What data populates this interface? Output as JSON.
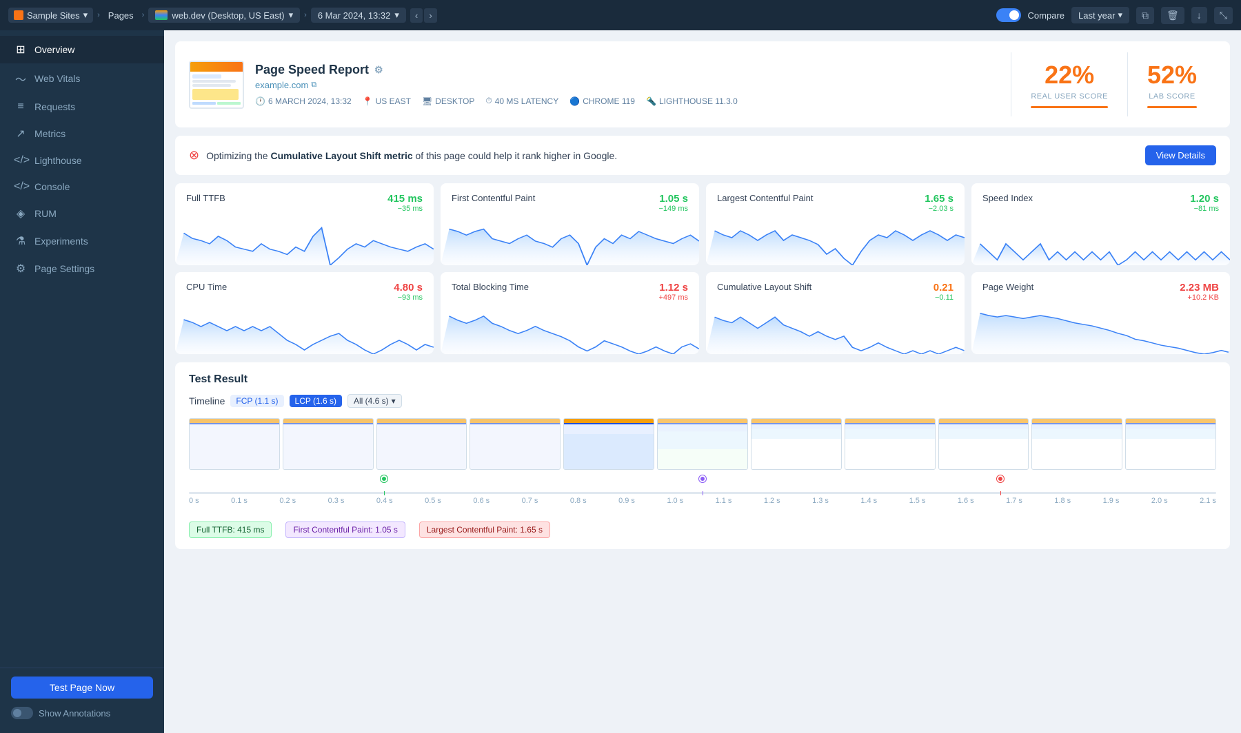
{
  "topNav": {
    "sampleSites": "Sample Sites",
    "pages": "Pages",
    "url": "web.dev (Desktop, US East)",
    "date": "6 Mar 2024, 13:32",
    "compareLabel": "Compare",
    "lastYear": "Last year"
  },
  "sidebar": {
    "items": [
      {
        "id": "overview",
        "label": "Overview",
        "icon": "⊞",
        "active": true
      },
      {
        "id": "web-vitals",
        "label": "Web Vitals",
        "icon": "〜"
      },
      {
        "id": "requests",
        "label": "Requests",
        "icon": "≡"
      },
      {
        "id": "metrics",
        "label": "Metrics",
        "icon": "↗"
      },
      {
        "id": "lighthouse",
        "label": "Lighthouse",
        "icon": "</>"
      },
      {
        "id": "console",
        "label": "Console",
        "icon": "</>"
      },
      {
        "id": "rum",
        "label": "RUM",
        "icon": "◈"
      },
      {
        "id": "experiments",
        "label": "Experiments",
        "icon": "⚗"
      },
      {
        "id": "page-settings",
        "label": "Page Settings",
        "icon": "⚙"
      }
    ],
    "testNowLabel": "Test Page Now",
    "showAnnotationsLabel": "Show Annotations"
  },
  "report": {
    "title": "Page Speed Report",
    "url": "example.com",
    "date": "6 MARCH 2024, 13:32",
    "region": "US EAST",
    "device": "DESKTOP",
    "latency": "40 MS LATENCY",
    "browser": "CHROME 119",
    "lighthouse": "LIGHTHOUSE 11.3.0",
    "realUserScore": "22%",
    "labScore": "52%",
    "realUserLabel": "REAL USER SCORE",
    "labLabel": "LAB SCORE"
  },
  "alert": {
    "text": "Optimizing the",
    "metric": "Cumulative Layout Shift metric",
    "suffix": "of this page could help it rank higher in Google.",
    "btnLabel": "View Details"
  },
  "metrics": [
    {
      "name": "Full TTFB",
      "value": "415 ms",
      "valueClass": "green",
      "delta": "−35 ms",
      "deltaClass": "green-delta",
      "sparkPoints": "10,65 20,60 30,58 40,55 50,62 60,58 70,52 80,50 90,48 100,55 110,50 120,48 130,45 140,52 150,48 160,62 170,70 180,35 190,42 200,50 210,55 220,52 230,58 240,55 250,52 260,50 270,48 280,52 290,55 300,50"
    },
    {
      "name": "First Contentful Paint",
      "value": "1.05 s",
      "valueClass": "green",
      "delta": "−149 ms",
      "deltaClass": "green-delta",
      "sparkPoints": "10,60 20,58 30,55 40,58 50,60 60,52 70,50 80,48 90,52 100,55 110,50 120,48 130,45 140,52 150,55 160,48 170,30 180,45 190,52 200,48 210,55 220,52 230,58 240,55 250,52 260,50 270,48 280,52 290,55 300,50"
    },
    {
      "name": "Largest Contentful Paint",
      "value": "1.65 s",
      "valueClass": "green",
      "delta": "−2.03 s",
      "deltaClass": "green-delta",
      "sparkPoints": "10,55 20,52 30,50 40,55 50,52 60,48 70,52 80,55 90,48 100,52 110,50 120,48 130,45 140,38 150,42 160,35 170,30 180,40 190,48 200,52 210,50 220,55 230,52 240,48 250,52 260,55 270,52 280,48 290,52 300,50"
    },
    {
      "name": "Speed Index",
      "value": "1.20 s",
      "valueClass": "green",
      "delta": "−81 ms",
      "deltaClass": "green-delta",
      "sparkPoints": "10,58 20,55 30,52 40,58 50,55 60,52 70,55 80,58 90,52 100,55 110,52 120,55 130,52 140,55 150,52 160,55 170,50 180,52 190,55 200,52 210,55 220,52 230,55 240,52 250,55 260,52 270,55 280,52 290,55 300,52"
    },
    {
      "name": "CPU Time",
      "value": "4.80 s",
      "valueClass": "red",
      "delta": "−93 ms",
      "deltaClass": "green-delta",
      "sparkPoints": "10,60 20,58 30,55 40,58 50,55 60,52 70,55 80,52 90,55 100,52 110,55 120,50 130,45 140,42 150,38 160,42 170,45 180,48 190,50 200,45 210,42 220,38 230,35 240,38 250,42 260,45 270,42 280,38 290,42 300,40"
    },
    {
      "name": "Total Blocking Time",
      "value": "1.12 s",
      "valueClass": "red",
      "delta": "+497 ms",
      "deltaClass": "red-delta",
      "sparkPoints": "10,62 20,58 30,55 40,58 50,62 60,55 70,52 80,48 90,45 100,48 110,52 120,48 130,45 140,42 150,38 160,32 170,28 180,32 190,38 200,35 210,32 220,28 230,25 240,28 250,32 260,28 270,25 280,32 290,35 300,30"
    },
    {
      "name": "Cumulative Layout Shift",
      "value": "0.21",
      "valueClass": "orange",
      "delta": "−0.11",
      "deltaClass": "green-delta",
      "sparkPoints": "10,65 20,62 30,60 40,65 50,60 60,55 70,60 80,65 90,58 100,55 110,52 120,48 130,52 140,48 150,45 160,48 170,38 180,35 190,38 200,42 210,38 220,35 230,32 240,35 250,32 260,35 270,32 280,35 290,38 300,35"
    },
    {
      "name": "Page Weight",
      "value": "2.23 MB",
      "valueClass": "red",
      "delta": "+10.2 KB",
      "deltaClass": "red-delta",
      "sparkPoints": "10,65 20,62 30,60 40,62 50,60 60,58 70,60 80,62 90,60 100,58 110,55 120,52 130,50 140,48 150,45 160,42 170,38 180,35 190,30 200,28 210,25 220,22 230,20 240,18 250,15 260,12 270,10 280,12 290,15 300,12"
    }
  ],
  "testResult": {
    "title": "Test Result",
    "timelineLabel": "Timeline",
    "fcpBadge": "FCP (1.1 s)",
    "lcpBadge": "LCP (1.6 s)",
    "allBadge": "All (4.6 s)",
    "markerFTTFB": "Full TTFB: 415 ms",
    "markerFCP": "First Contentful Paint: 1.05 s",
    "markerLCP": "Largest Contentful Paint: 1.65 s",
    "rulerTicks": [
      "0 s",
      "0.1 s",
      "0.2 s",
      "0.3 s",
      "0.4 s",
      "0.5 s",
      "0.6 s",
      "0.7 s",
      "0.8 s",
      "0.9 s",
      "1.0 s",
      "1.1 s",
      "1.2 s",
      "1.3 s",
      "1.4 s",
      "1.5 s",
      "1.6 s",
      "1.7 s",
      "1.8 s",
      "1.9 s",
      "2.0 s",
      "2.1 s"
    ]
  }
}
